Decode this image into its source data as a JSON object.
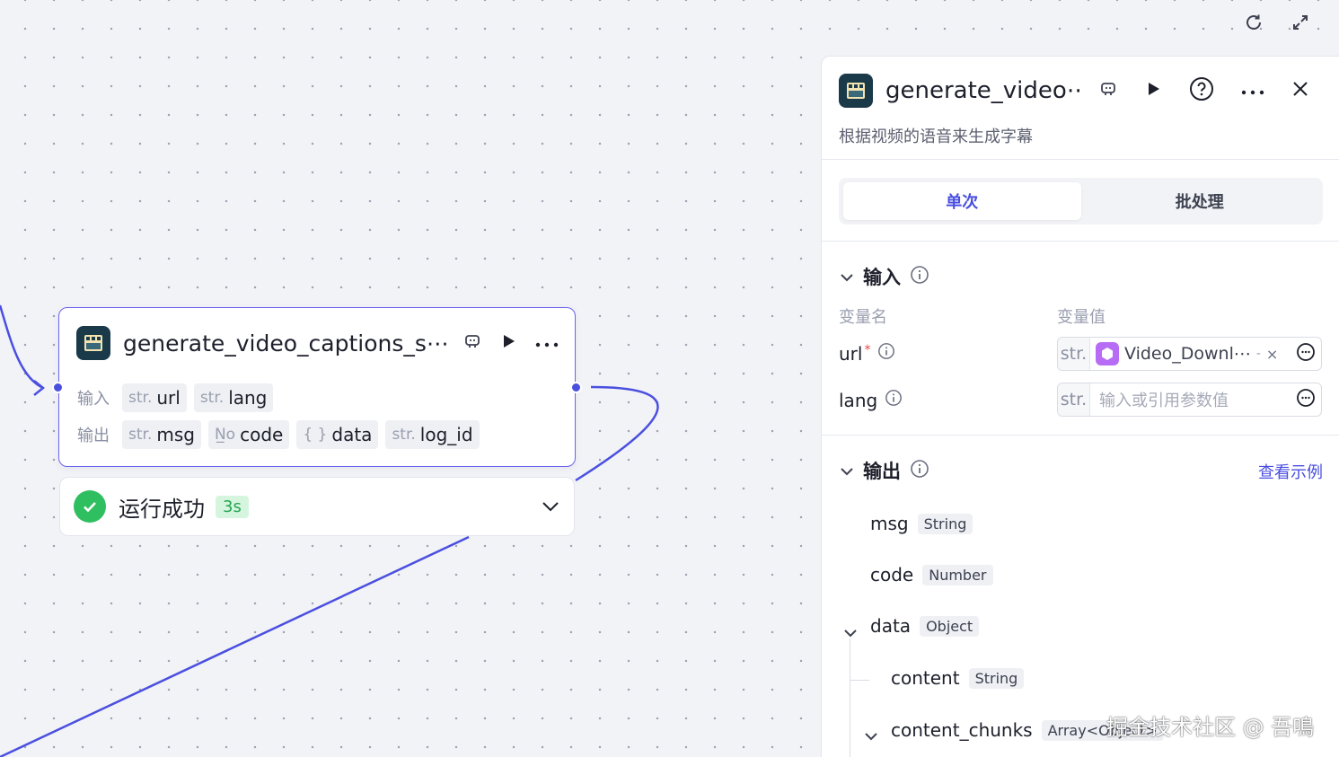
{
  "toolbar": {
    "refresh_icon": "refresh-icon",
    "expand_icon": "expand-icon"
  },
  "node": {
    "title": "generate_video_captions_s⋯",
    "input_label": "输入",
    "output_label": "输出",
    "inputs": [
      {
        "type": "str.",
        "name": "url"
      },
      {
        "type": "str.",
        "name": "lang"
      }
    ],
    "outputs": [
      {
        "type": "str.",
        "name": "msg"
      },
      {
        "type": "N̲o",
        "name": "code"
      },
      {
        "type": "{ }",
        "name": "data"
      },
      {
        "type": "str.",
        "name": "log_id"
      }
    ]
  },
  "status": {
    "text": "运行成功",
    "duration": "3s"
  },
  "panel": {
    "title": "generate_video⋯",
    "description": "根据视频的语音来生成字幕",
    "tabs": [
      "单次",
      "批处理"
    ],
    "input_section": {
      "title": "输入",
      "col_name": "变量名",
      "col_value": "变量值",
      "vars": [
        {
          "name": "url",
          "required": "*",
          "type": "str.",
          "ref": "Video_Downl⋯",
          "ref_suffix": "-"
        },
        {
          "name": "lang",
          "type": "str.",
          "placeholder": "输入或引用参数值"
        }
      ]
    },
    "output_section": {
      "title": "输出",
      "link": "查看示例",
      "fields": [
        {
          "name": "msg",
          "type": "String"
        },
        {
          "name": "code",
          "type": "Number"
        },
        {
          "name": "data",
          "type": "Object"
        },
        {
          "name": "content",
          "type": "String"
        },
        {
          "name": "content_chunks",
          "type": "Array<Object>"
        }
      ]
    }
  },
  "watermark": "掘金技术社区 @ 吾鳴",
  "colors": {
    "accent": "#4a4fe0",
    "success": "#2fbf60",
    "wire": "#4a4fe0"
  }
}
